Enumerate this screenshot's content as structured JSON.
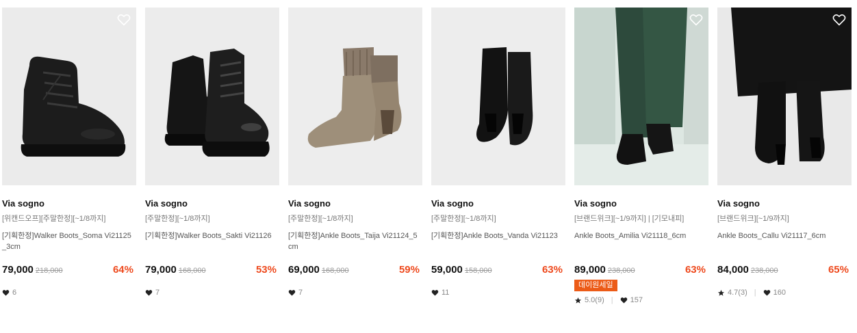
{
  "products": [
    {
      "brand": "Via sogno",
      "tag": "[위캔드오프][주말한정][~1/8까지]",
      "name": "[기획한정]Walker Boots_Soma Vi21125_3cm",
      "price": "79,000",
      "original_price": "218,000",
      "discount": "64%",
      "likes": "6",
      "badge": "",
      "rating": "",
      "image": "black-lace-up-combat-boot",
      "wishlist_icon": "heart-outline-icon"
    },
    {
      "brand": "Via sogno",
      "tag": "[주말한정][~1/8까지]",
      "name": "[기획한정]Walker Boots_Sakti Vi21126",
      "price": "79,000",
      "original_price": "168,000",
      "discount": "53%",
      "likes": "7",
      "badge": "",
      "rating": "",
      "image": "black-patent-lug-boots-pair",
      "wishlist_icon": ""
    },
    {
      "brand": "Via sogno",
      "tag": "[주말한정][~1/8까지]",
      "name": "[기획한정]Ankle Boots_Taija Vi21124_5cm",
      "price": "69,000",
      "original_price": "168,000",
      "discount": "59%",
      "likes": "7",
      "badge": "",
      "rating": "",
      "image": "taupe-knit-ankle-boots",
      "wishlist_icon": ""
    },
    {
      "brand": "Via sogno",
      "tag": "[주말한정][~1/8까지]",
      "name": "[기획한정]Ankle Boots_Vanda Vi21123",
      "price": "59,000",
      "original_price": "158,000",
      "discount": "63%",
      "likes": "11",
      "badge": "",
      "rating": "",
      "image": "black-suede-ankle-boot",
      "wishlist_icon": ""
    },
    {
      "brand": "Via sogno",
      "tag": "[브랜드위크][~1/9까지] | [기모내피]",
      "name": "Ankle Boots_Amilia Vi21118_6cm",
      "price": "89,000",
      "original_price": "238,000",
      "discount": "63%",
      "likes": "157",
      "badge": "데이원세일",
      "rating": "5.0(9)",
      "image": "model-green-pants-black-boots",
      "wishlist_icon": "heart-outline-icon"
    },
    {
      "brand": "Via sogno",
      "tag": "[브랜드위크][~1/9까지]",
      "name": "Ankle Boots_Callu Vi21117_6cm",
      "price": "84,000",
      "original_price": "238,000",
      "discount": "65%",
      "likes": "160",
      "badge": "",
      "rating": "4.7(3)",
      "image": "model-black-skirt-black-boots",
      "wishlist_icon": "heart-outline-icon"
    }
  ],
  "colors": {
    "discount": "#ee4a1e",
    "badge": "#ec5b17"
  }
}
